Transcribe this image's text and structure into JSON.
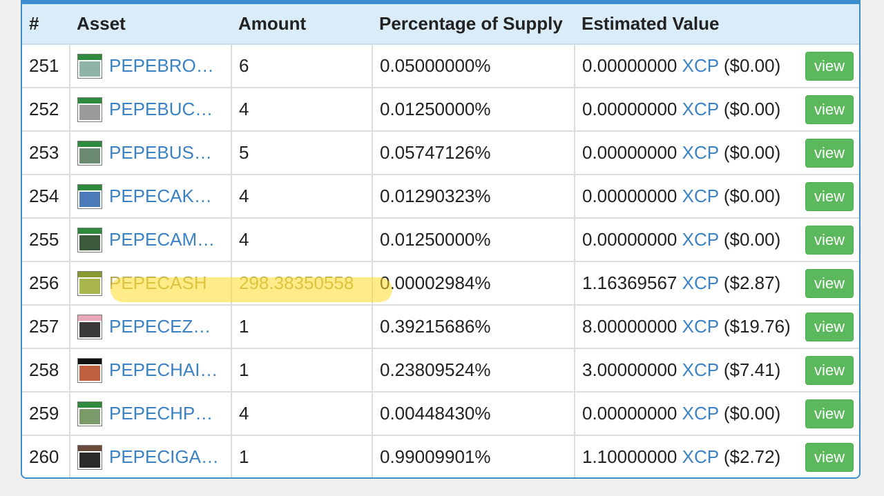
{
  "table": {
    "headers": {
      "num": "#",
      "asset": "Asset",
      "amount": "Amount",
      "percentage": "Percentage of Supply",
      "value": "Estimated Value"
    },
    "xcp_label": "XCP",
    "view_label": "view",
    "rows": [
      {
        "num": "251",
        "asset": "PEPEBRO…",
        "amount": "6",
        "pct": "0.05000000%",
        "value": "0.00000000",
        "usd": "($0.00)",
        "thumb": [
          "#2e8b3e",
          "#8fb4a6"
        ]
      },
      {
        "num": "252",
        "asset": "PEPEBUC…",
        "amount": "4",
        "pct": "0.01250000%",
        "value": "0.00000000",
        "usd": "($0.00)",
        "thumb": [
          "#2e8b3e",
          "#9a9a9a"
        ]
      },
      {
        "num": "253",
        "asset": "PEPEBUS…",
        "amount": "5",
        "pct": "0.05747126%",
        "value": "0.00000000",
        "usd": "($0.00)",
        "thumb": [
          "#2e8b3e",
          "#6a8a70"
        ]
      },
      {
        "num": "254",
        "asset": "PEPECAK…",
        "amount": "4",
        "pct": "0.01290323%",
        "value": "0.00000000",
        "usd": "($0.00)",
        "thumb": [
          "#2e8b3e",
          "#4a7ab8"
        ]
      },
      {
        "num": "255",
        "asset": "PEPECAM…",
        "amount": "4",
        "pct": "0.01250000%",
        "value": "0.00000000",
        "usd": "($0.00)",
        "thumb": [
          "#2e8b3e",
          "#3d5a3d"
        ]
      },
      {
        "num": "256",
        "asset": "PEPECASH",
        "amount": "298.38350558",
        "pct": "0.00002984%",
        "value": "1.16369567",
        "usd": "($2.87)",
        "thumb": [
          "#8a9a2e",
          "#a8b54a"
        ],
        "highlighted": true
      },
      {
        "num": "257",
        "asset": "PEPECEZ…",
        "amount": "1",
        "pct": "0.39215686%",
        "value": "8.00000000",
        "usd": "($19.76)",
        "thumb": [
          "#e8a8b8",
          "#3a3a3a"
        ]
      },
      {
        "num": "258",
        "asset": "PEPECHAI…",
        "amount": "1",
        "pct": "0.23809524%",
        "value": "3.00000000",
        "usd": "($7.41)",
        "thumb": [
          "#111111",
          "#c06040"
        ]
      },
      {
        "num": "259",
        "asset": "PEPECHP…",
        "amount": "4",
        "pct": "0.00448430%",
        "value": "0.00000000",
        "usd": "($0.00)",
        "thumb": [
          "#2e8b3e",
          "#7a9a6a"
        ]
      },
      {
        "num": "260",
        "asset": "PEPECIGA…",
        "amount": "1",
        "pct": "0.99009901%",
        "value": "1.10000000",
        "usd": "($2.72)",
        "thumb": [
          "#6a4a3a",
          "#2a2a2a"
        ]
      }
    ]
  }
}
